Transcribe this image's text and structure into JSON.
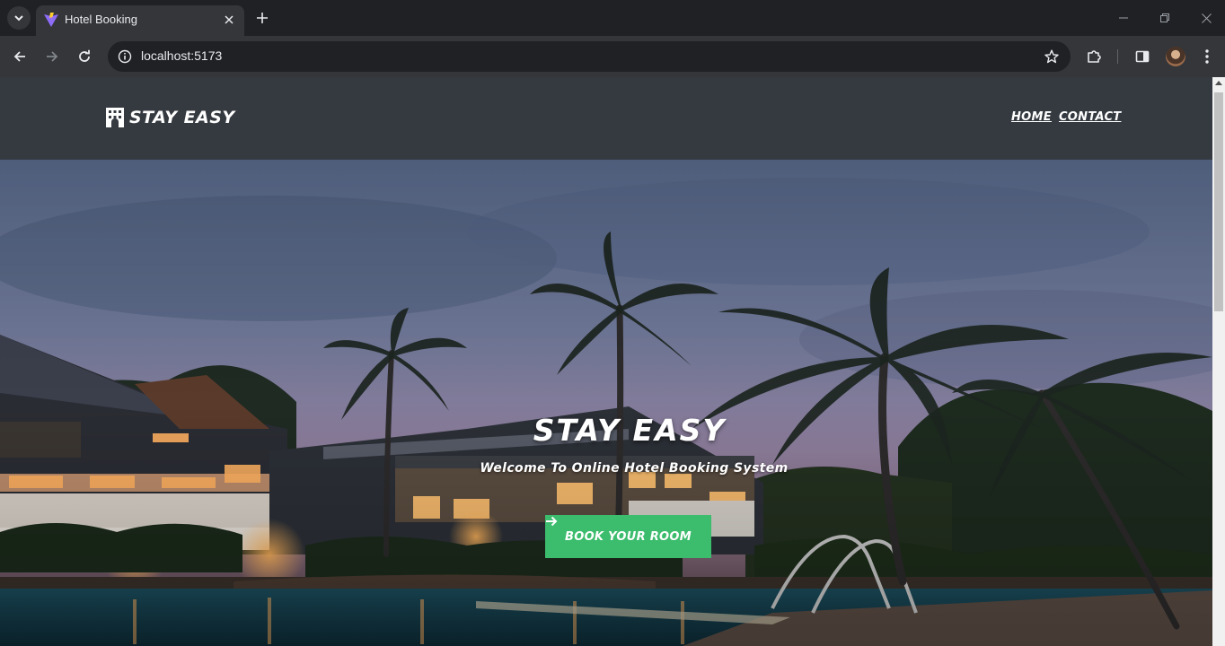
{
  "browser": {
    "tab_title": "Hotel Booking",
    "url": "localhost:5173"
  },
  "site": {
    "brand": "STAY EASY",
    "nav": [
      {
        "label": "HOME"
      },
      {
        "label": "CONTACT"
      }
    ]
  },
  "hero": {
    "title": "STAY EASY",
    "subtitle": "Welcome To Online Hotel Booking System",
    "cta_label": "BOOK YOUR ROOM",
    "cta_icon": "arrow-right-icon"
  },
  "colors": {
    "navbar": "#343a40",
    "cta": "#3cbc6d",
    "browser_frame": "#202124",
    "browser_toolbar": "#35363a"
  },
  "icons": [
    "chevron-down-icon",
    "vite-favicon-icon",
    "close-icon",
    "plus-icon",
    "minimize-icon",
    "restore-icon",
    "back-arrow-icon",
    "forward-arrow-icon",
    "reload-icon",
    "info-icon",
    "star-icon",
    "extensions-icon",
    "sidepanel-icon",
    "profile-avatar",
    "more-vert-icon",
    "hotel-building-icon",
    "arrow-right-icon"
  ]
}
